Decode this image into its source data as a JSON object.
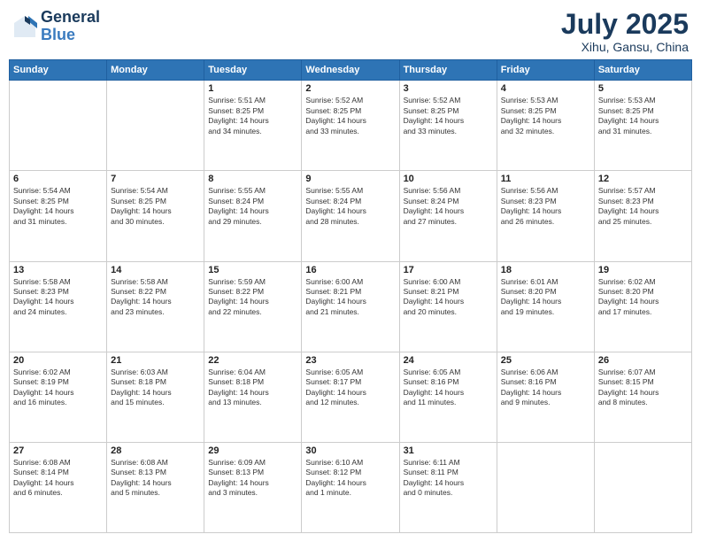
{
  "header": {
    "logo_line1": "General",
    "logo_line2": "Blue",
    "month": "July 2025",
    "location": "Xihu, Gansu, China"
  },
  "weekdays": [
    "Sunday",
    "Monday",
    "Tuesday",
    "Wednesday",
    "Thursday",
    "Friday",
    "Saturday"
  ],
  "weeks": [
    [
      {
        "day": "",
        "info": ""
      },
      {
        "day": "",
        "info": ""
      },
      {
        "day": "1",
        "info": "Sunrise: 5:51 AM\nSunset: 8:25 PM\nDaylight: 14 hours\nand 34 minutes."
      },
      {
        "day": "2",
        "info": "Sunrise: 5:52 AM\nSunset: 8:25 PM\nDaylight: 14 hours\nand 33 minutes."
      },
      {
        "day": "3",
        "info": "Sunrise: 5:52 AM\nSunset: 8:25 PM\nDaylight: 14 hours\nand 33 minutes."
      },
      {
        "day": "4",
        "info": "Sunrise: 5:53 AM\nSunset: 8:25 PM\nDaylight: 14 hours\nand 32 minutes."
      },
      {
        "day": "5",
        "info": "Sunrise: 5:53 AM\nSunset: 8:25 PM\nDaylight: 14 hours\nand 31 minutes."
      }
    ],
    [
      {
        "day": "6",
        "info": "Sunrise: 5:54 AM\nSunset: 8:25 PM\nDaylight: 14 hours\nand 31 minutes."
      },
      {
        "day": "7",
        "info": "Sunrise: 5:54 AM\nSunset: 8:25 PM\nDaylight: 14 hours\nand 30 minutes."
      },
      {
        "day": "8",
        "info": "Sunrise: 5:55 AM\nSunset: 8:24 PM\nDaylight: 14 hours\nand 29 minutes."
      },
      {
        "day": "9",
        "info": "Sunrise: 5:55 AM\nSunset: 8:24 PM\nDaylight: 14 hours\nand 28 minutes."
      },
      {
        "day": "10",
        "info": "Sunrise: 5:56 AM\nSunset: 8:24 PM\nDaylight: 14 hours\nand 27 minutes."
      },
      {
        "day": "11",
        "info": "Sunrise: 5:56 AM\nSunset: 8:23 PM\nDaylight: 14 hours\nand 26 minutes."
      },
      {
        "day": "12",
        "info": "Sunrise: 5:57 AM\nSunset: 8:23 PM\nDaylight: 14 hours\nand 25 minutes."
      }
    ],
    [
      {
        "day": "13",
        "info": "Sunrise: 5:58 AM\nSunset: 8:23 PM\nDaylight: 14 hours\nand 24 minutes."
      },
      {
        "day": "14",
        "info": "Sunrise: 5:58 AM\nSunset: 8:22 PM\nDaylight: 14 hours\nand 23 minutes."
      },
      {
        "day": "15",
        "info": "Sunrise: 5:59 AM\nSunset: 8:22 PM\nDaylight: 14 hours\nand 22 minutes."
      },
      {
        "day": "16",
        "info": "Sunrise: 6:00 AM\nSunset: 8:21 PM\nDaylight: 14 hours\nand 21 minutes."
      },
      {
        "day": "17",
        "info": "Sunrise: 6:00 AM\nSunset: 8:21 PM\nDaylight: 14 hours\nand 20 minutes."
      },
      {
        "day": "18",
        "info": "Sunrise: 6:01 AM\nSunset: 8:20 PM\nDaylight: 14 hours\nand 19 minutes."
      },
      {
        "day": "19",
        "info": "Sunrise: 6:02 AM\nSunset: 8:20 PM\nDaylight: 14 hours\nand 17 minutes."
      }
    ],
    [
      {
        "day": "20",
        "info": "Sunrise: 6:02 AM\nSunset: 8:19 PM\nDaylight: 14 hours\nand 16 minutes."
      },
      {
        "day": "21",
        "info": "Sunrise: 6:03 AM\nSunset: 8:18 PM\nDaylight: 14 hours\nand 15 minutes."
      },
      {
        "day": "22",
        "info": "Sunrise: 6:04 AM\nSunset: 8:18 PM\nDaylight: 14 hours\nand 13 minutes."
      },
      {
        "day": "23",
        "info": "Sunrise: 6:05 AM\nSunset: 8:17 PM\nDaylight: 14 hours\nand 12 minutes."
      },
      {
        "day": "24",
        "info": "Sunrise: 6:05 AM\nSunset: 8:16 PM\nDaylight: 14 hours\nand 11 minutes."
      },
      {
        "day": "25",
        "info": "Sunrise: 6:06 AM\nSunset: 8:16 PM\nDaylight: 14 hours\nand 9 minutes."
      },
      {
        "day": "26",
        "info": "Sunrise: 6:07 AM\nSunset: 8:15 PM\nDaylight: 14 hours\nand 8 minutes."
      }
    ],
    [
      {
        "day": "27",
        "info": "Sunrise: 6:08 AM\nSunset: 8:14 PM\nDaylight: 14 hours\nand 6 minutes."
      },
      {
        "day": "28",
        "info": "Sunrise: 6:08 AM\nSunset: 8:13 PM\nDaylight: 14 hours\nand 5 minutes."
      },
      {
        "day": "29",
        "info": "Sunrise: 6:09 AM\nSunset: 8:13 PM\nDaylight: 14 hours\nand 3 minutes."
      },
      {
        "day": "30",
        "info": "Sunrise: 6:10 AM\nSunset: 8:12 PM\nDaylight: 14 hours\nand 1 minute."
      },
      {
        "day": "31",
        "info": "Sunrise: 6:11 AM\nSunset: 8:11 PM\nDaylight: 14 hours\nand 0 minutes."
      },
      {
        "day": "",
        "info": ""
      },
      {
        "day": "",
        "info": ""
      }
    ]
  ]
}
